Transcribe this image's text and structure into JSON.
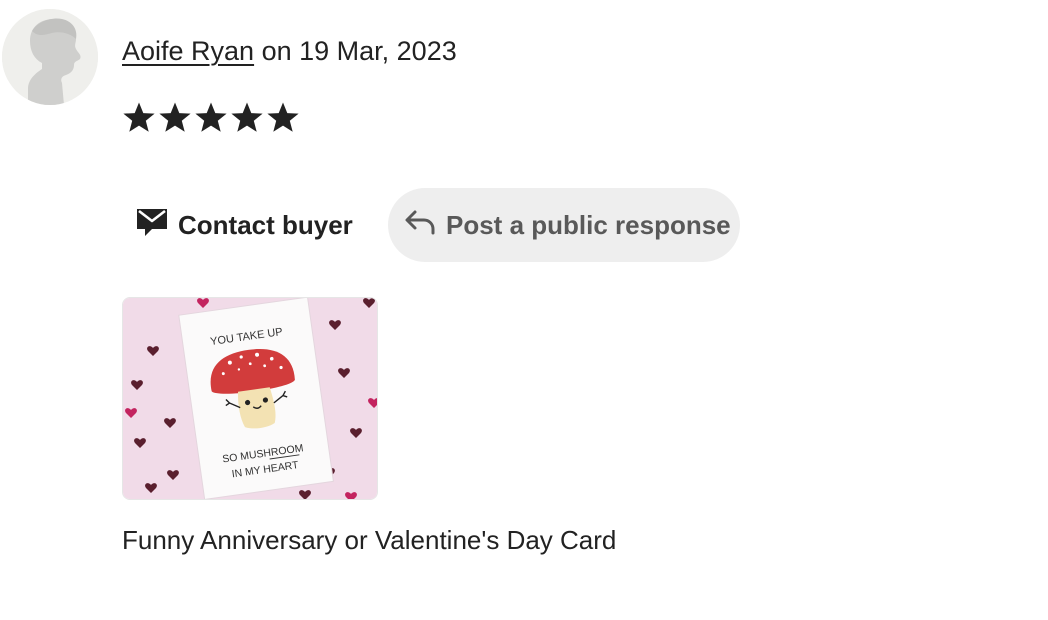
{
  "review": {
    "reviewer_name": "Aoife Ryan",
    "date_text": " on 19 Mar, 2023",
    "rating": 5,
    "rating_max": 5,
    "star_color": "#222222",
    "avatar_icon": "default-user-silhouette-icon"
  },
  "actions": {
    "contact_label": "Contact buyer",
    "contact_icon": "envelope-icon",
    "respond_label": "Post a public response",
    "respond_icon": "reply-arrow-icon"
  },
  "listing": {
    "title": "Funny Anniversary or Valentine's Day Card",
    "card_text_top": "YOU TAKE UP",
    "card_text_bottom_1": "SO MUSHROOM",
    "card_text_bottom_2": "IN MY HEART",
    "background_color": "#f1dbe8",
    "mushroom_color": "#d23c3c"
  }
}
